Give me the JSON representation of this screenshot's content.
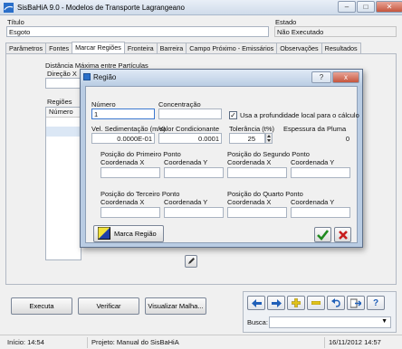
{
  "window": {
    "title": "SisBaHiA 9.0 - Modelos de Transporte Lagrangeano"
  },
  "header": {
    "titulo_label": "Título",
    "titulo_value": "Esgoto",
    "estado_label": "Estado",
    "estado_value": "Não Executado"
  },
  "tabs": [
    {
      "label": "Parâmetros"
    },
    {
      "label": "Fontes"
    },
    {
      "label": "Marcar Regiões"
    },
    {
      "label": "Fronteira"
    },
    {
      "label": "Barreira"
    },
    {
      "label": "Campo Próximo - Emissários"
    },
    {
      "label": "Observações"
    },
    {
      "label": "Resultados"
    }
  ],
  "panel": {
    "distancia_label": "Distância Máxima entre Partículas",
    "direcao_label": "Direção X",
    "regioes_label": "Regiões",
    "numero_header": "Número"
  },
  "dialog": {
    "title": "Região",
    "help_glyph": "?",
    "close_glyph": "x",
    "numero_label": "Número",
    "numero_value": "1",
    "concentracao_label": "Concentração",
    "concentracao_value": "",
    "usa_prof_label": "Usa a profundidade local para o cálculo",
    "usa_prof_checked": "✓",
    "vel_sed_label": "Vel. Sedimentação (m/s)",
    "vel_sed_value": "0.0000E-01",
    "valor_cond_label": "Valor Condicionante",
    "valor_cond_value": "0.0001",
    "tolerancia_label": "Tolerância (t%)",
    "tolerancia_value": "25",
    "espessura_label": "Espessura da Pluma",
    "espessura_value": "0",
    "p1_title": "Posição do Primeiro Ponto",
    "p2_title": "Posição do Segundo Ponto",
    "p3_title": "Posição do Terceiro Ponto",
    "p4_title": "Posição do Quarto Ponto",
    "coord_x": "Coordenada X",
    "coord_y": "Coordenada Y",
    "marca_regiao_label": "Marca Região"
  },
  "bottom": {
    "executa_label": "Executa",
    "verificar_label": "Verificar",
    "visualizar_label": "Visualizar Malha...",
    "busca_label": "Busca:"
  },
  "status": {
    "inicio": "Início: 14:54",
    "projeto": "Projeto: Manual do SisBaHiA",
    "data": "16/11/2012 14:57"
  },
  "colors": {
    "accent_blue": "#1f5fb8",
    "ok_green": "#1f8a1f",
    "cancel_red": "#c81e1e"
  }
}
